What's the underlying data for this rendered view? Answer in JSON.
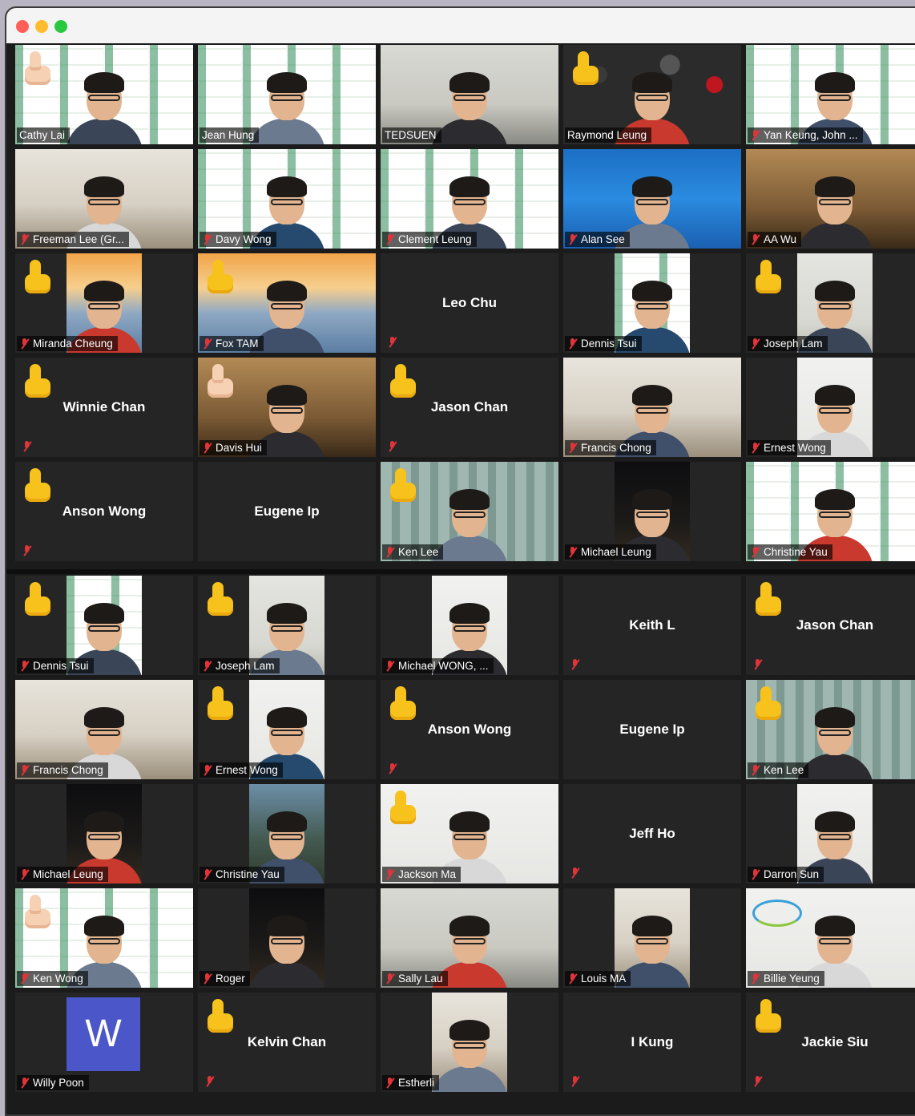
{
  "window": {
    "controls": [
      "close",
      "minimize",
      "zoom"
    ],
    "control_colors": [
      "#ff5f57",
      "#febc2e",
      "#28c840"
    ]
  },
  "gallery_top": [
    {
      "name": "Cathy Lai",
      "mode": "video",
      "bg": "slides",
      "reaction": "thumbs-up-light"
    },
    {
      "name": "Jean Hung",
      "mode": "video",
      "bg": "slides"
    },
    {
      "name": "TEDSUEN",
      "mode": "video",
      "bg": "office-gray"
    },
    {
      "name": "Raymond Leung",
      "mode": "video",
      "bg": "cherries",
      "reaction": "thumbs-up",
      "active": true
    },
    {
      "name": "Yan Keung, John ...",
      "mode": "video",
      "bg": "slides",
      "muted": true
    },
    {
      "name": "Freeman Lee (Gr...",
      "mode": "video",
      "bg": "room-light",
      "muted": true
    },
    {
      "name": "Davy Wong",
      "mode": "video",
      "bg": "slides",
      "muted": true
    },
    {
      "name": "Clement Leung",
      "mode": "video",
      "bg": "slides",
      "muted": true
    },
    {
      "name": "Alan See",
      "mode": "video",
      "bg": "ocean",
      "muted": true
    },
    {
      "name": "AA Wu",
      "mode": "video",
      "bg": "room-warm",
      "muted": true
    },
    {
      "name": "Miranda Cheung",
      "mode": "video",
      "bg": "bridge",
      "narrow": true,
      "reaction": "thumbs-up",
      "muted": true
    },
    {
      "name": "Fox TAM",
      "mode": "video",
      "bg": "bridge",
      "reaction": "thumbs-up",
      "muted": true
    },
    {
      "name": "Leo Chu",
      "mode": "name",
      "muted": true
    },
    {
      "name": "Dennis Tsui",
      "mode": "video",
      "bg": "slides",
      "narrow": true,
      "muted": true
    },
    {
      "name": "Joseph Lam",
      "mode": "video",
      "bg": "wall",
      "narrow": true,
      "reaction": "wave",
      "muted": true
    },
    {
      "name": "Winnie Chan",
      "mode": "name",
      "reaction": "thumbs-up",
      "muted": true
    },
    {
      "name": "Davis Hui",
      "mode": "video",
      "bg": "room-warm",
      "reaction": "thumbs-up-light",
      "muted": true
    },
    {
      "name": "Jason Chan",
      "mode": "name",
      "reaction": "thumbs-up",
      "muted": true
    },
    {
      "name": "Francis Chong",
      "mode": "video",
      "bg": "room-light",
      "muted": true
    },
    {
      "name": "Ernest Wong",
      "mode": "video",
      "bg": "white",
      "narrow": true,
      "muted": true
    },
    {
      "name": "Anson Wong",
      "mode": "name",
      "reaction": "thumbs-up",
      "muted": true
    },
    {
      "name": "Eugene Ip",
      "mode": "name"
    },
    {
      "name": "Ken Lee",
      "mode": "video",
      "bg": "curtain",
      "reaction": "thumbs-up",
      "muted": true
    },
    {
      "name": "Michael Leung",
      "mode": "video",
      "bg": "night",
      "narrow": true,
      "muted": true
    },
    {
      "name": "Christine Yau",
      "mode": "video",
      "bg": "slides",
      "muted": true
    }
  ],
  "gallery_bottom": [
    {
      "name": "Dennis Tsui",
      "mode": "video",
      "bg": "slides",
      "narrow": true,
      "reaction": "thumbs-up",
      "muted": true
    },
    {
      "name": "Joseph Lam",
      "mode": "video",
      "bg": "wall",
      "narrow": true,
      "reaction": "thumbs-up",
      "muted": true
    },
    {
      "name": "Michael WONG, ...",
      "mode": "video",
      "bg": "white",
      "narrow": true,
      "muted": true
    },
    {
      "name": "Keith L",
      "mode": "name",
      "muted": true
    },
    {
      "name": "Jason Chan",
      "mode": "name",
      "reaction": "thumbs-up",
      "muted": true
    },
    {
      "name": "Francis Chong",
      "mode": "video",
      "bg": "room-light",
      "muted": true
    },
    {
      "name": "Ernest Wong",
      "mode": "video",
      "bg": "white",
      "narrow": true,
      "reaction": "thumbs-up",
      "muted": true
    },
    {
      "name": "Anson Wong",
      "mode": "name",
      "reaction": "thumbs-up",
      "muted": true
    },
    {
      "name": "Eugene Ip",
      "mode": "name"
    },
    {
      "name": "Ken Lee",
      "mode": "video",
      "bg": "curtain",
      "reaction": "thumbs-up",
      "muted": true
    },
    {
      "name": "Michael Leung",
      "mode": "video",
      "bg": "night",
      "narrow": true,
      "muted": true
    },
    {
      "name": "Christine Yau",
      "mode": "video",
      "bg": "rocks",
      "narrow": true,
      "muted": true
    },
    {
      "name": "Jackson Ma",
      "mode": "video",
      "bg": "white",
      "reaction": "thumbs-up",
      "muted": true
    },
    {
      "name": "Jeff Ho",
      "mode": "name",
      "muted": true
    },
    {
      "name": "Darron Sun",
      "mode": "video",
      "bg": "white",
      "narrow": true,
      "muted": true
    },
    {
      "name": "Ken Wong",
      "mode": "video",
      "bg": "slides",
      "reaction": "thumbs-up-light",
      "muted": true
    },
    {
      "name": "Roger",
      "mode": "video",
      "bg": "night",
      "narrow": true,
      "muted": true
    },
    {
      "name": "Sally Lau",
      "mode": "video",
      "bg": "office-gray",
      "muted": true
    },
    {
      "name": "Louis MA",
      "mode": "video",
      "bg": "room-light",
      "narrow": true,
      "muted": true
    },
    {
      "name": "Billie Yeung",
      "mode": "video",
      "bg": "white",
      "muted": true,
      "logo": "LEAP"
    },
    {
      "name": "Willy Poon",
      "mode": "avatar",
      "avatar_letter": "W",
      "muted": true
    },
    {
      "name": "Kelvin Chan",
      "mode": "name",
      "reaction": "thumbs-up",
      "muted": true
    },
    {
      "name": "Estherli",
      "mode": "video",
      "bg": "room-light",
      "narrow": true,
      "muted": true
    },
    {
      "name": "I Kung",
      "mode": "name",
      "muted": true
    },
    {
      "name": "Jackie Siu",
      "mode": "name",
      "reaction": "thumbs-up",
      "muted": true
    }
  ],
  "colors": {
    "tile_bg": "#252526",
    "active_speaker_border": "#d7ec4a",
    "mic_muted": "#e0343a",
    "avatar_bg": "#4b57c9",
    "reaction_yellow": "#f6c21b"
  }
}
